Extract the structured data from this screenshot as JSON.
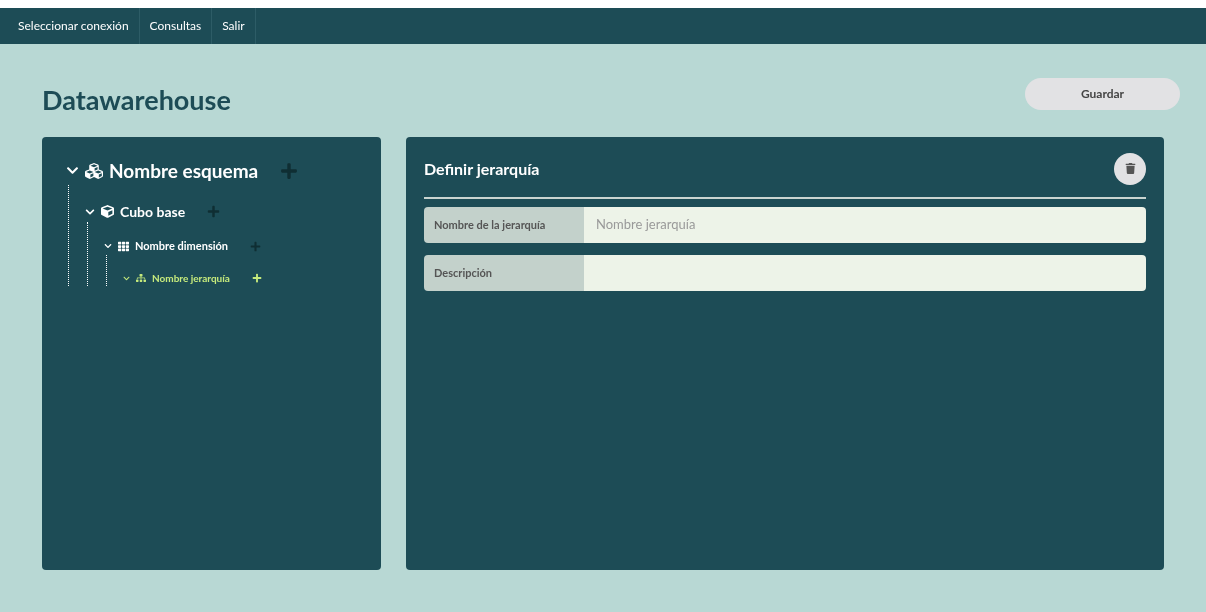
{
  "nav": [
    {
      "label": "Seleccionar conexión"
    },
    {
      "label": "Consultas"
    },
    {
      "label": "Salir"
    }
  ],
  "title": "Datawarehouse",
  "save_button": "Guardar",
  "tree": [
    {
      "kind": "schema",
      "label": "Nombre esquema",
      "expanded": true,
      "selected": false,
      "children": [
        {
          "kind": "cube",
          "label": "Cubo base",
          "expanded": true,
          "selected": false,
          "children": [
            {
              "kind": "dimension",
              "label": "Nombre dimensión",
              "expanded": true,
              "selected": false,
              "children": [
                {
                  "kind": "hierarchy",
                  "label": "Nombre jerarquía",
                  "expanded": true,
                  "selected": true
                }
              ]
            }
          ]
        }
      ]
    }
  ],
  "form": {
    "title": "Definir jerarquía",
    "fields": [
      {
        "label": "Nombre de la jerarquía",
        "placeholder": "Nombre jerarquía"
      },
      {
        "label": "Descripción"
      }
    ]
  }
}
